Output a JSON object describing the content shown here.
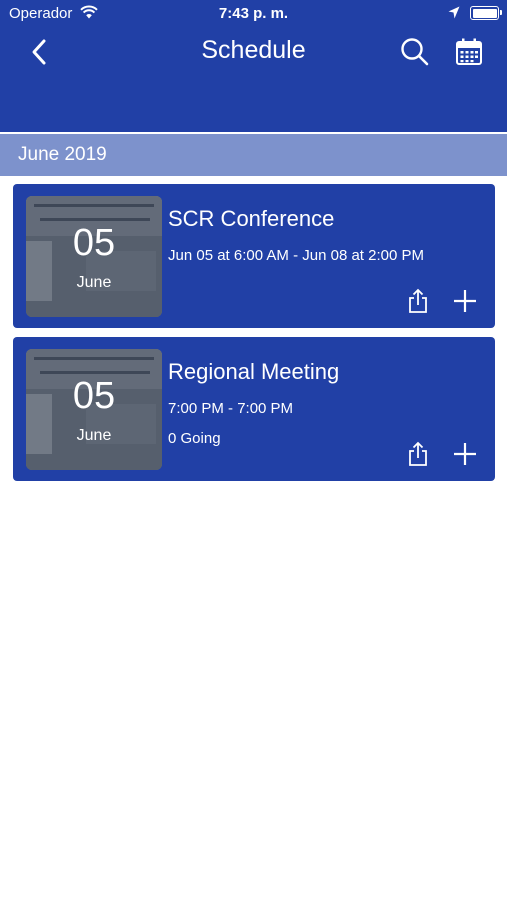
{
  "status_bar": {
    "carrier": "Operador",
    "time": "7:43 p. m."
  },
  "nav": {
    "title": "Schedule",
    "back_icon": "chevron-left-icon",
    "search_icon": "search-icon",
    "calendar_icon": "calendar-icon"
  },
  "section": {
    "title": "June 2019"
  },
  "events": [
    {
      "title": "SCR Conference",
      "day": "05",
      "month": "June",
      "time": "Jun 05 at 6:00 AM - Jun 08 at 2:00 PM",
      "going": ""
    },
    {
      "title": "Regional Meeting",
      "day": "05",
      "month": "June",
      "time": "7:00 PM - 7:00 PM",
      "going": "0 Going"
    }
  ],
  "colors": {
    "header": "#2140a6",
    "section_header": "#7d92cc",
    "card": "#2140a6"
  }
}
